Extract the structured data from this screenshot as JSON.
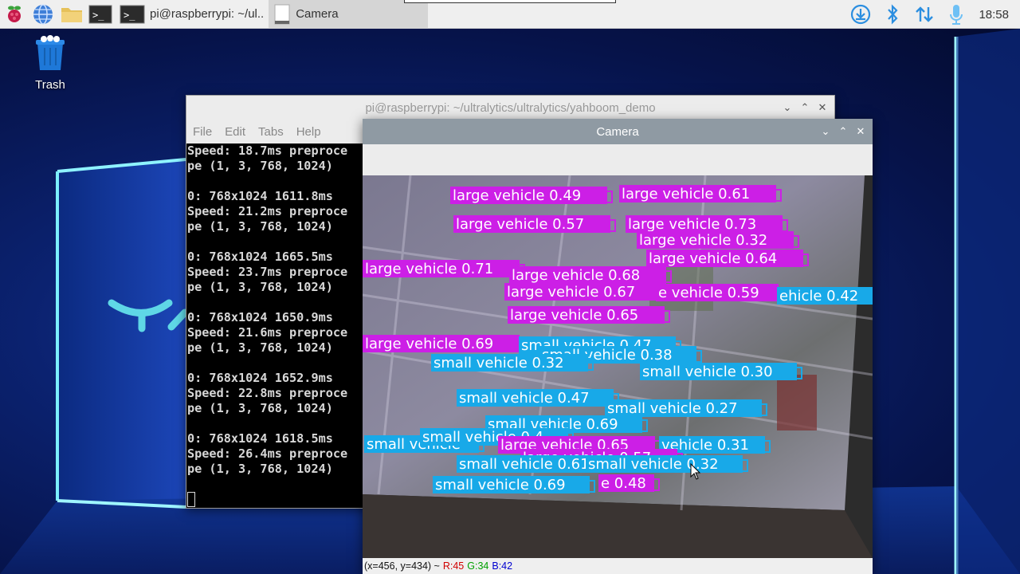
{
  "panel": {
    "tasks": [
      {
        "name": "terminal-task-1",
        "label": ""
      },
      {
        "name": "terminal-task-2",
        "label": "pi@raspberrypi: ~/ul.."
      },
      {
        "name": "camera-task",
        "label": "Camera"
      }
    ],
    "clock": "18:58"
  },
  "desktop": {
    "trash_label": "Trash"
  },
  "terminal": {
    "title": "pi@raspberrypi: ~/ultralytics/ultralytics/yahboom_demo",
    "menu": [
      "File",
      "Edit",
      "Tabs",
      "Help"
    ],
    "lines": [
      "Speed: 18.7ms preproce",
      "pe (1, 3, 768, 1024)",
      "",
      "0: 768x1024 1611.8ms",
      "Speed: 21.2ms preproce",
      "pe (1, 3, 768, 1024)",
      "",
      "0: 768x1024 1665.5ms",
      "Speed: 23.7ms preproce",
      "pe (1, 3, 768, 1024)",
      "",
      "0: 768x1024 1650.9ms",
      "Speed: 21.6ms preproce",
      "pe (1, 3, 768, 1024)",
      "",
      "0: 768x1024 1652.9ms",
      "Speed: 22.8ms preproce",
      "pe (1, 3, 768, 1024)",
      "",
      "0: 768x1024 1618.5ms",
      "Speed: 26.4ms preproce",
      "pe (1, 3, 768, 1024)"
    ]
  },
  "camera": {
    "title": "Camera",
    "status": {
      "coords": "(x=456, y=434) ~",
      "r": "R:45",
      "g": "G:34",
      "b": "B:42"
    },
    "colors": {
      "large": "#cc1fe6",
      "small": "#18a9e8"
    },
    "detections": [
      {
        "text": "large vehicle 0.49",
        "cls": "large"
      },
      {
        "text": "large vehicle 0.61",
        "cls": "large"
      },
      {
        "text": "large vehicle 0.57",
        "cls": "large"
      },
      {
        "text": "large vehicle 0.73",
        "cls": "large"
      },
      {
        "text": "large vehicle 0.32",
        "cls": "large"
      },
      {
        "text": "large vehicle 0.64",
        "cls": "large"
      },
      {
        "text": "large vehicle 0.71",
        "cls": "large"
      },
      {
        "text": "large vehicle 0.68",
        "cls": "large"
      },
      {
        "text": "large vehicle 0.67",
        "cls": "large"
      },
      {
        "text": "e vehicle 0.59",
        "cls": "large"
      },
      {
        "text": "ehicle 0.42",
        "cls": "small"
      },
      {
        "text": "large vehicle 0.65",
        "cls": "large"
      },
      {
        "text": "large vehicle 0.69",
        "cls": "large"
      },
      {
        "text": "small vehicle 0.47",
        "cls": "small"
      },
      {
        "text": "small vehicle 0.38",
        "cls": "small"
      },
      {
        "text": "small vehicle 0.32",
        "cls": "small"
      },
      {
        "text": "small vehicle 0.30",
        "cls": "small"
      },
      {
        "text": "small vehicle 0.47",
        "cls": "small"
      },
      {
        "text": "small vehicle 0.27",
        "cls": "small"
      },
      {
        "text": "small vehicle 0.69",
        "cls": "small"
      },
      {
        "text": "small vehicle",
        "cls": "small"
      },
      {
        "text": "small vehicle 0.4",
        "cls": "small"
      },
      {
        "text": "large vehicle 0.65",
        "cls": "large"
      },
      {
        "text": "vehicle 0.31",
        "cls": "small"
      },
      {
        "text": "large vehicle 0.57",
        "cls": "large"
      },
      {
        "text": "small vehicle 0.61",
        "cls": "small"
      },
      {
        "text": "small vehicle 0.32",
        "cls": "small"
      },
      {
        "text": "small vehicle 0.69",
        "cls": "small"
      },
      {
        "text": "e 0.48",
        "cls": "large"
      }
    ]
  }
}
